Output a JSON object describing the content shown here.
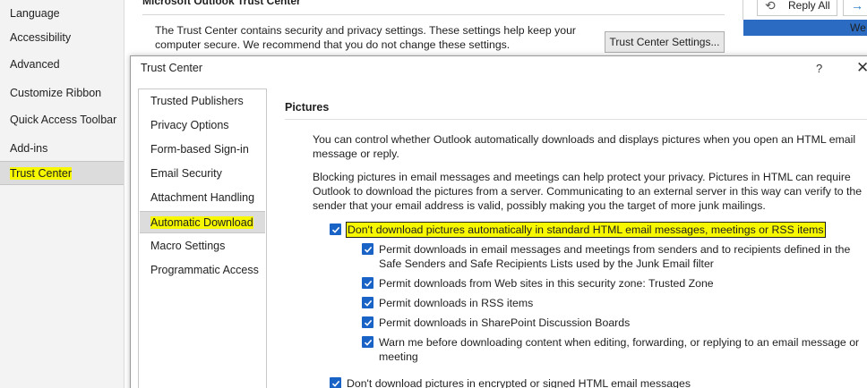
{
  "options_nav": {
    "items": [
      {
        "label": "Language",
        "active": false
      },
      {
        "label": "Accessibility",
        "active": false
      },
      {
        "label": "Advanced",
        "active": false
      },
      {
        "label": "Customize Ribbon",
        "active": false
      },
      {
        "label": "Quick Access Toolbar",
        "active": false
      },
      {
        "label": "Add-ins",
        "active": false
      },
      {
        "label": "Trust Center",
        "active": true
      }
    ]
  },
  "background": {
    "heading": "Microsoft Outlook Trust Center",
    "description": "The Trust Center contains security and privacy settings. These settings help keep your computer secure. We recommend that you do not change these settings.",
    "settings_button": "Trust Center Settings...",
    "reply_all": "Reply All",
    "we_text": "We"
  },
  "dialog": {
    "title": "Trust Center",
    "help": "?",
    "close": "✕",
    "categories": [
      {
        "label": "Trusted Publishers",
        "active": false
      },
      {
        "label": "Privacy Options",
        "active": false
      },
      {
        "label": "Form-based Sign-in",
        "active": false
      },
      {
        "label": "Email Security",
        "active": false
      },
      {
        "label": "Attachment Handling",
        "active": false
      },
      {
        "label": "Automatic Download",
        "active": true
      },
      {
        "label": "Macro Settings",
        "active": false
      },
      {
        "label": "Programmatic Access",
        "active": false
      }
    ],
    "section_title": "Pictures",
    "intro": "You can control whether Outlook automatically downloads and displays pictures when you open an HTML email message or reply.",
    "blocking": "Blocking pictures in email messages and meetings can help protect your privacy. Pictures in HTML can require Outlook to download the pictures from a server. Communicating to an external server in this way can verify to the sender that your email address is valid, possibly making you the target of more junk mailings.",
    "options": {
      "main": {
        "label": "Don't download pictures automatically in standard HTML email messages, meetings or RSS items",
        "checked": true
      },
      "permit_safe_senders": {
        "label": "Permit downloads in email messages and meetings from senders and to recipients defined in the Safe Senders and Safe Recipients Lists used by the Junk Email filter",
        "checked": true
      },
      "permit_trusted_zone": {
        "label": "Permit downloads from Web sites in this security zone: Trusted Zone",
        "checked": true
      },
      "permit_rss": {
        "label": "Permit downloads in RSS items",
        "checked": true
      },
      "permit_sharepoint": {
        "label": "Permit downloads in SharePoint Discussion Boards",
        "checked": true
      },
      "warn": {
        "label": "Warn me before downloading content when editing, forwarding, or replying to an email message or meeting",
        "checked": true
      },
      "encrypted": {
        "label": "Don't download pictures in encrypted or signed HTML email messages",
        "checked": true
      }
    }
  },
  "colors": {
    "checkbox": "#1a63c6",
    "highlight": "#f7f700",
    "accent_bar": "#2b6cc2"
  }
}
